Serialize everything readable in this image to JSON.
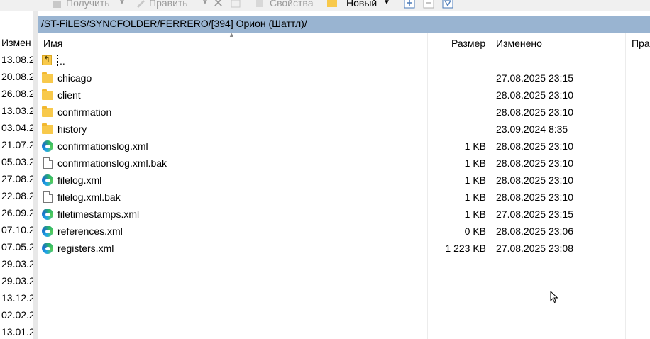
{
  "toolbar": {
    "get_label": "Получить",
    "edit_label": "Править",
    "props_label": "Свойства",
    "new_label": "Новый"
  },
  "left_pane": {
    "header": "Измен",
    "dates": [
      "13.08.2",
      "20.08.2",
      "26.08.2",
      "13.03.2",
      "03.04.2",
      "21.07.2",
      "05.03.2",
      "27.08.2",
      "22.08.2",
      "26.09.2",
      "07.10.2",
      "07.05.2",
      "29.03.2",
      "29.03.2",
      "13.12.2",
      "02.02.2",
      "13.01.2"
    ]
  },
  "path": "/ST-FiLES/SYNCFOLDER/FERRERO/[394] Орион (Шаттл)/",
  "columns": {
    "name": "Имя",
    "size": "Размер",
    "modified": "Изменено",
    "rights": "Пра"
  },
  "files": [
    {
      "name": "..",
      "size": "",
      "modified": "",
      "icon": "up-folder-icon"
    },
    {
      "name": "chicago",
      "size": "",
      "modified": "27.08.2025 23:15",
      "icon": "folder-icon"
    },
    {
      "name": "client",
      "size": "",
      "modified": "28.08.2025 23:10",
      "icon": "folder-icon"
    },
    {
      "name": "confirmation",
      "size": "",
      "modified": "28.08.2025 23:10",
      "icon": "folder-icon"
    },
    {
      "name": "history",
      "size": "",
      "modified": "23.09.2024 8:35",
      "icon": "folder-icon"
    },
    {
      "name": "confirmationslog.xml",
      "size": "1 KB",
      "modified": "28.08.2025 23:10",
      "icon": "edge-icon"
    },
    {
      "name": "confirmationslog.xml.bak",
      "size": "1 KB",
      "modified": "28.08.2025 23:10",
      "icon": "file-icon"
    },
    {
      "name": "filelog.xml",
      "size": "1 KB",
      "modified": "28.08.2025 23:10",
      "icon": "edge-icon"
    },
    {
      "name": "filelog.xml.bak",
      "size": "1 KB",
      "modified": "28.08.2025 23:10",
      "icon": "file-icon"
    },
    {
      "name": "filetimestamps.xml",
      "size": "1 KB",
      "modified": "27.08.2025 23:15",
      "icon": "edge-icon"
    },
    {
      "name": "references.xml",
      "size": "0 KB",
      "modified": "28.08.2025 23:06",
      "icon": "edge-icon"
    },
    {
      "name": "registers.xml",
      "size": "1 223 KB",
      "modified": "27.08.2025 23:08",
      "icon": "edge-icon"
    }
  ]
}
